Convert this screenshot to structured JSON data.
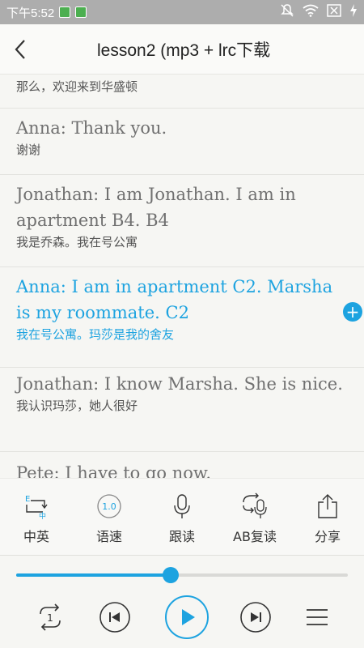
{
  "status_bar": {
    "time": "下午5:52",
    "icons": [
      "battery-saver-icon",
      "android-icon",
      "mute-icon",
      "wifi-icon",
      "sim-off-icon",
      "charging-icon"
    ]
  },
  "nav": {
    "back_icon": "chevron-left-icon",
    "title": "lesson2 (mp3 + lrc下载"
  },
  "lyrics": [
    {
      "zh": "那么，欢迎来到华盛顿"
    },
    {
      "en": "Anna: Thank you.",
      "zh": "谢谢"
    },
    {
      "en": "Jonathan: I am Jonathan. I am in apartment B4. B4",
      "zh": "我是乔森。我在号公寓"
    },
    {
      "en": "Anna: I am in apartment C2. Marsha is my roommate. C2",
      "zh": "我在号公寓。玛莎是我的舍友",
      "active": true
    },
    {
      "en": "Jonathan: I know Marsha. She is nice.",
      "zh": "我认识玛莎，她人很好"
    },
    {
      "en": "Pete: I have to go now."
    }
  ],
  "add_button": "+",
  "toolbar": {
    "items": [
      {
        "label": "中英",
        "icon": "language-switch-icon"
      },
      {
        "label": "语速",
        "icon": "speed-icon",
        "badge": "1.0"
      },
      {
        "label": "跟读",
        "icon": "microphone-icon"
      },
      {
        "label": "AB复读",
        "icon": "ab-repeat-icon"
      },
      {
        "label": "分享",
        "icon": "share-icon"
      }
    ]
  },
  "player": {
    "progress": 0.465,
    "repeat_badge": "1",
    "icons": [
      "repeat-one-icon",
      "previous-icon",
      "play-icon",
      "next-icon",
      "menu-icon"
    ]
  },
  "colors": {
    "accent": "#1da3e0",
    "status_bar": "#adadad"
  }
}
